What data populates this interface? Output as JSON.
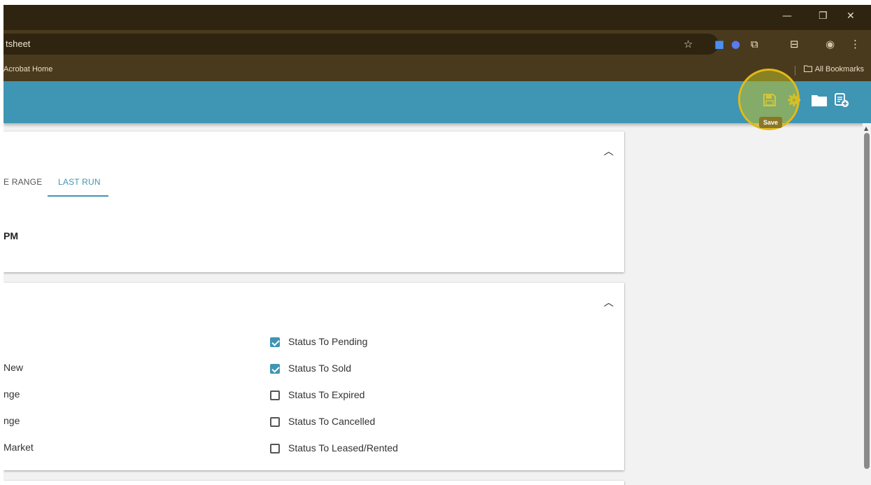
{
  "browser": {
    "address_text": "tsheet",
    "bookmark_left": "Acrobat Home",
    "bookmark_right": "All Bookmarks"
  },
  "header": {
    "tooltip": "Save"
  },
  "card1": {
    "tab_partial": "E RANGE",
    "tab_active": "LAST RUN",
    "run_time": "PM"
  },
  "card2": {
    "left_items": [
      "New",
      "nge",
      "nge",
      "Market"
    ],
    "checkboxes": [
      {
        "label": "Status To Pending",
        "checked": true
      },
      {
        "label": "Status To Sold",
        "checked": true
      },
      {
        "label": "Status To Expired",
        "checked": false
      },
      {
        "label": "Status To Cancelled",
        "checked": false
      },
      {
        "label": "Status To Leased/Rented",
        "checked": false
      }
    ]
  },
  "colors": {
    "accent": "#3f95b4",
    "highlight": "#e3b918",
    "browser_dark": "#2f2410"
  }
}
